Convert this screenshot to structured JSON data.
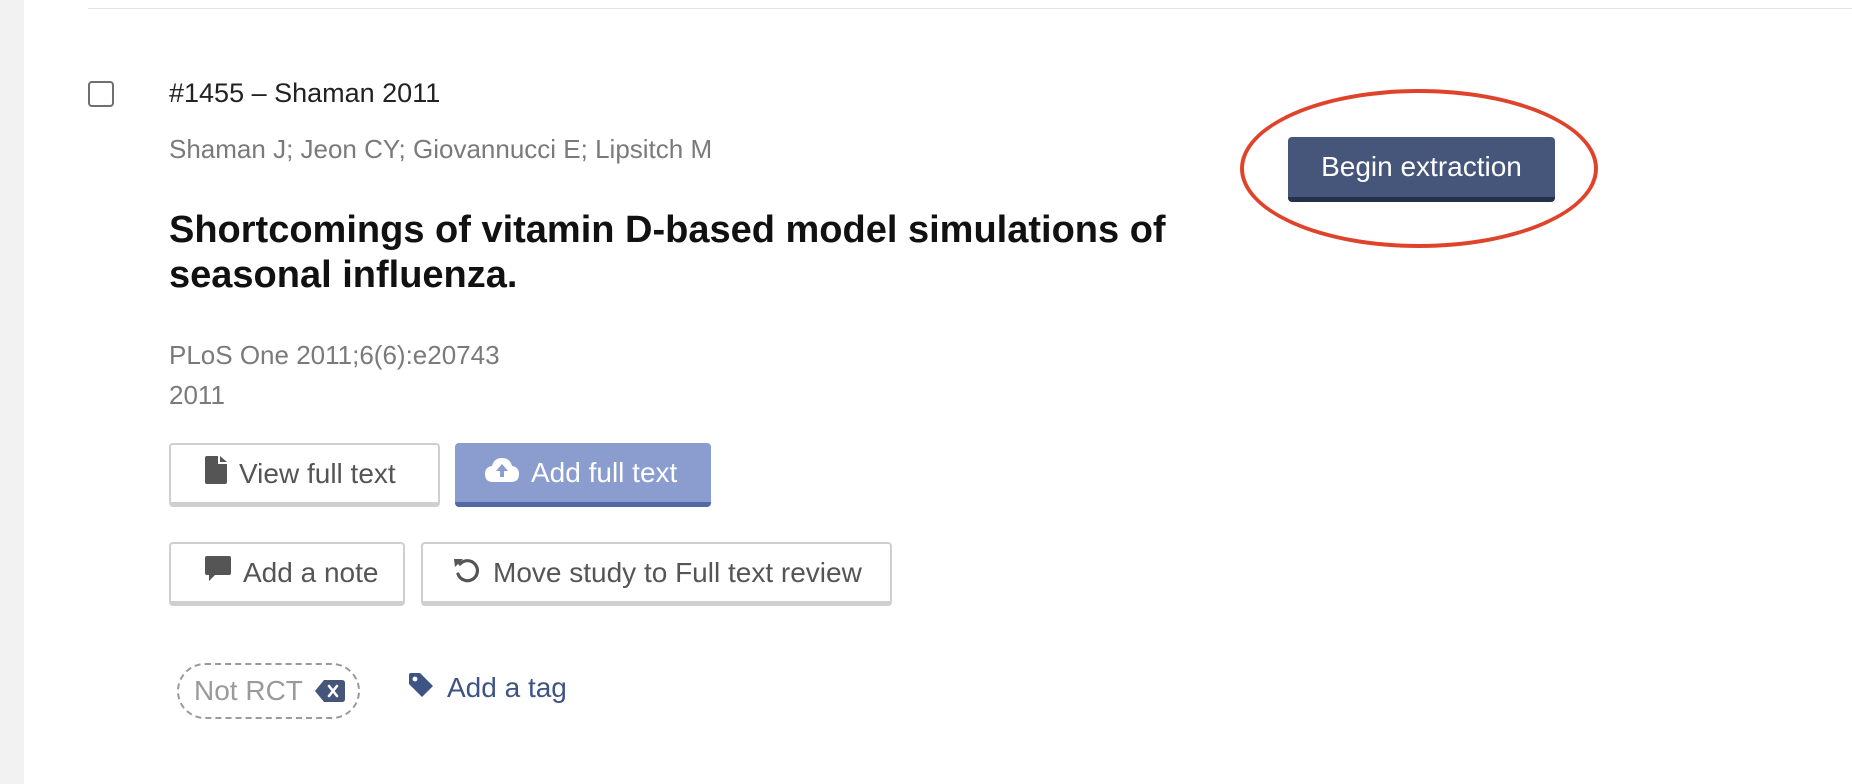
{
  "study": {
    "id_line": "#1455 – Shaman 2011",
    "authors": "Shaman J; Jeon CY; Giovannucci E; Lipsitch M",
    "title": "Shortcomings of vitamin D-based model simulations of seasonal influenza.",
    "citation": "PLoS One 2011;6(6):e20743",
    "year": "2011"
  },
  "actions": {
    "view_full_text": {
      "label": "View full text",
      "icon": "file-icon"
    },
    "add_full_text": {
      "label": "Add full text",
      "icon": "cloud-upload-icon"
    },
    "add_note": {
      "label": "Add a note",
      "icon": "comment-icon"
    },
    "move_study": {
      "label": "Move study to Full text review",
      "icon": "undo-icon"
    },
    "begin_extraction": {
      "label": "Begin extraction"
    }
  },
  "tags": {
    "items": [
      {
        "label": "Not RCT",
        "remove_icon": "backspace-icon"
      }
    ],
    "add_label": "Add a tag",
    "add_icon": "tag-icon"
  },
  "colors": {
    "primary_button": "#45567a",
    "add_full_text_button": "#8a9dce",
    "annotation_ring": "#e0432b",
    "link": "#3e5484"
  }
}
